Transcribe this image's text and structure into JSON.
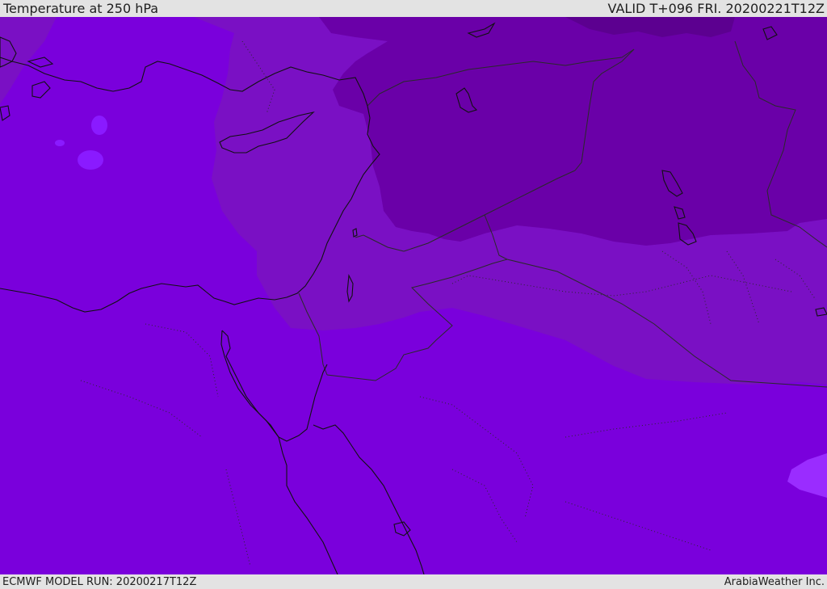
{
  "header": {
    "title": "Temperature at 250 hPa",
    "valid_time": "VALID T+096 FRI. 20200221T12Z"
  },
  "footer": {
    "model_run": "ECMWF MODEL RUN: 20200217T12Z",
    "credit": "ArabiaWeather Inc."
  },
  "map": {
    "colors": {
      "background_fill": "#7a00dc",
      "mid_band": "#7a10c4",
      "cold_band": "#6a00a8",
      "coldest_band": "#5c0090",
      "warm_spot": "#8a1aff",
      "warmest_spot": "#9a2cff",
      "coastline": "#111111",
      "border": "#2a2a2a"
    }
  }
}
